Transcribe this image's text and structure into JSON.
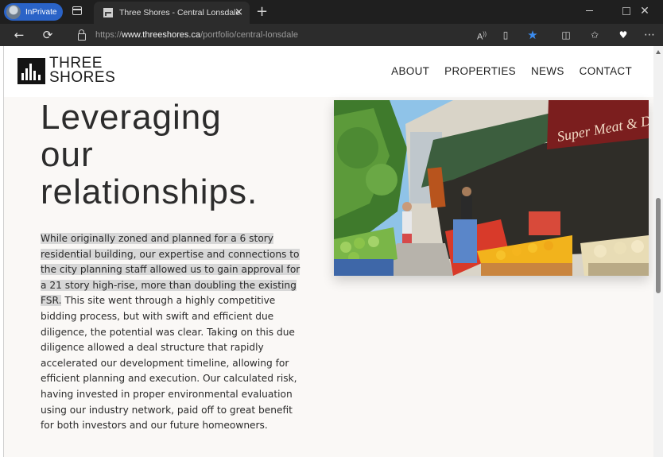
{
  "browser": {
    "profile_label": "InPrivate",
    "tab": {
      "title": "Three Shores - Central Lonsdale",
      "close": "×"
    },
    "new_tab": "+",
    "window": {
      "close": "✕"
    },
    "nav": {
      "back": "←",
      "refresh": "⟳"
    },
    "url": {
      "scheme": "https://",
      "host": "www.threeshores.ca",
      "path": "/portfolio/central-lonsdale"
    },
    "toolbar_icons": [
      "read-aloud-icon",
      "immersive-reader-icon",
      "favorite-star-icon",
      "split-screen-icon",
      "favorites-icon",
      "browser-essentials-icon",
      "more-icon"
    ]
  },
  "site": {
    "logo": {
      "line1": "THREE",
      "line2": "SHORES"
    },
    "nav": [
      "ABOUT",
      "PROPERTIES",
      "NEWS",
      "CONTACT"
    ]
  },
  "hero": {
    "title_lines": [
      "Leveraging",
      "our",
      "relationships."
    ],
    "body_selected": "While originally zoned and planned for a 6 story residential building, our expertise and connections to the city planning staff allowed us to gain approval for a 21 story high-rise, more than doubling the existing FSR.",
    "body_rest": " This site went through a highly competitive bidding process, but with swift and efficient due diligence, the potential was clear. Taking on this due diligence allowed a deal structure that rapidly accelerated our development timeline, allowing for efficient planning and execution. Our calculated risk, having invested in proper environmental evaluation using our industry network, paid off to great benefit for both investors and our future homeowners."
  },
  "photo": {
    "sign_text": "Super Meat & Deli"
  },
  "colors": {
    "accent": "#2a63c7",
    "star": "#3b8cf0",
    "page_bg": "#faf8f6"
  }
}
